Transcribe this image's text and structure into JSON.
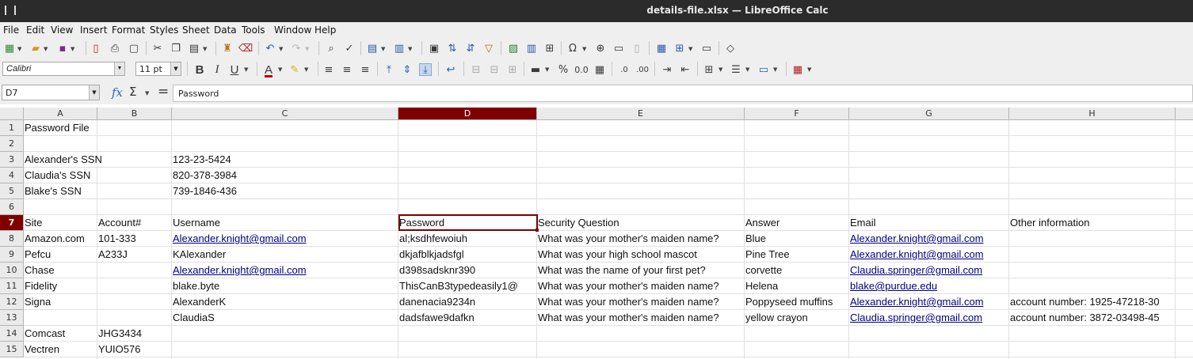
{
  "window": {
    "title": "details-file.xlsx — LibreOffice Calc"
  },
  "menu": [
    "File",
    "Edit",
    "View",
    "Insert",
    "Format",
    "Styles",
    "Sheet",
    "Data",
    "Tools",
    "Window",
    "Help"
  ],
  "format_toolbar": {
    "font_name": "Calibri",
    "font_size": "11 pt",
    "bold": "B",
    "italic": "I",
    "underline": "U",
    "font_color": "A",
    "percent": "%",
    "decimal": "0.0"
  },
  "formula_bar": {
    "name_box": "D7",
    "fx": "fx",
    "sigma": "Σ",
    "equals": "=",
    "content": "Password"
  },
  "columns": [
    "A",
    "B",
    "C",
    "D",
    "E",
    "F",
    "G",
    "H"
  ],
  "selected_cell": "D7",
  "rows": [
    "1",
    "2",
    "3",
    "4",
    "5",
    "6",
    "7",
    "8",
    "9",
    "10",
    "11",
    "12",
    "13",
    "14",
    "15"
  ],
  "cells": {
    "A1": "Password File",
    "A3": "Alexander's SSN",
    "C3": "123-23-5424",
    "A4": "Claudia's SSN",
    "C4": "820-378-3984",
    "A5": "Blake's SSN",
    "C5": "739-1846-436",
    "A7": "Site",
    "B7": "Account#",
    "C7": "Username",
    "D7": "Password",
    "E7": "Security Question",
    "F7": "Answer",
    "G7": "Email",
    "H7": "Other information",
    "A8": "Amazon.com",
    "B8": "101-333",
    "C8": "Alexander.knight@gmail.com",
    "D8": "al;ksdhfewoiuh",
    "E8": "What was your mother's maiden name?",
    "F8": "Blue",
    "G8": "Alexander.knight@gmail.com",
    "A9": "Pefcu",
    "B9": "A233J",
    "C9": "KAlexander",
    "D9": "dkjafblkjadsfgl",
    "E9": "What was your high school mascot",
    "F9": "Pine Tree",
    "G9": "Alexander.knight@gmail.com",
    "A10": "Chase",
    "C10": "Alexander.knight@gmail.com",
    "D10": "d398sadsknr390",
    "E10": "What was the name of your first pet?",
    "F10": "corvette",
    "G10": "Claudia.springer@gmail.com",
    "A11": "Fidelity",
    "C11": "blake.byte",
    "D11": "ThisCanB3typedeasily1@",
    "E11": "What was your mother's maiden name?",
    "F11": "Helena",
    "G11": "blake@purdue.edu",
    "A12": "Signa",
    "C12": "AlexanderK",
    "D12": "danenacia9234n",
    "E12": "What was your mother's maiden name?",
    "F12": "Poppyseed muffins",
    "G12": "Alexander.knight@gmail.com",
    "H12": "account number: 1925-47218-30",
    "C13": "ClaudiaS",
    "D13": "dadsfawe9dafkn",
    "E13": "What was your mother's maiden name?",
    "F13": "yellow crayon",
    "G13": "Claudia.springer@gmail.com",
    "H13": "account number: 3872-03498-45",
    "A14": "Comcast",
    "B14": "JHG3434",
    "A15": "Vectren",
    "B15": "YUIO576"
  },
  "colors": {
    "selection": "#800000",
    "link": "#000080",
    "titlebar": "#2b2b2b",
    "toolbar": "#efefef"
  }
}
